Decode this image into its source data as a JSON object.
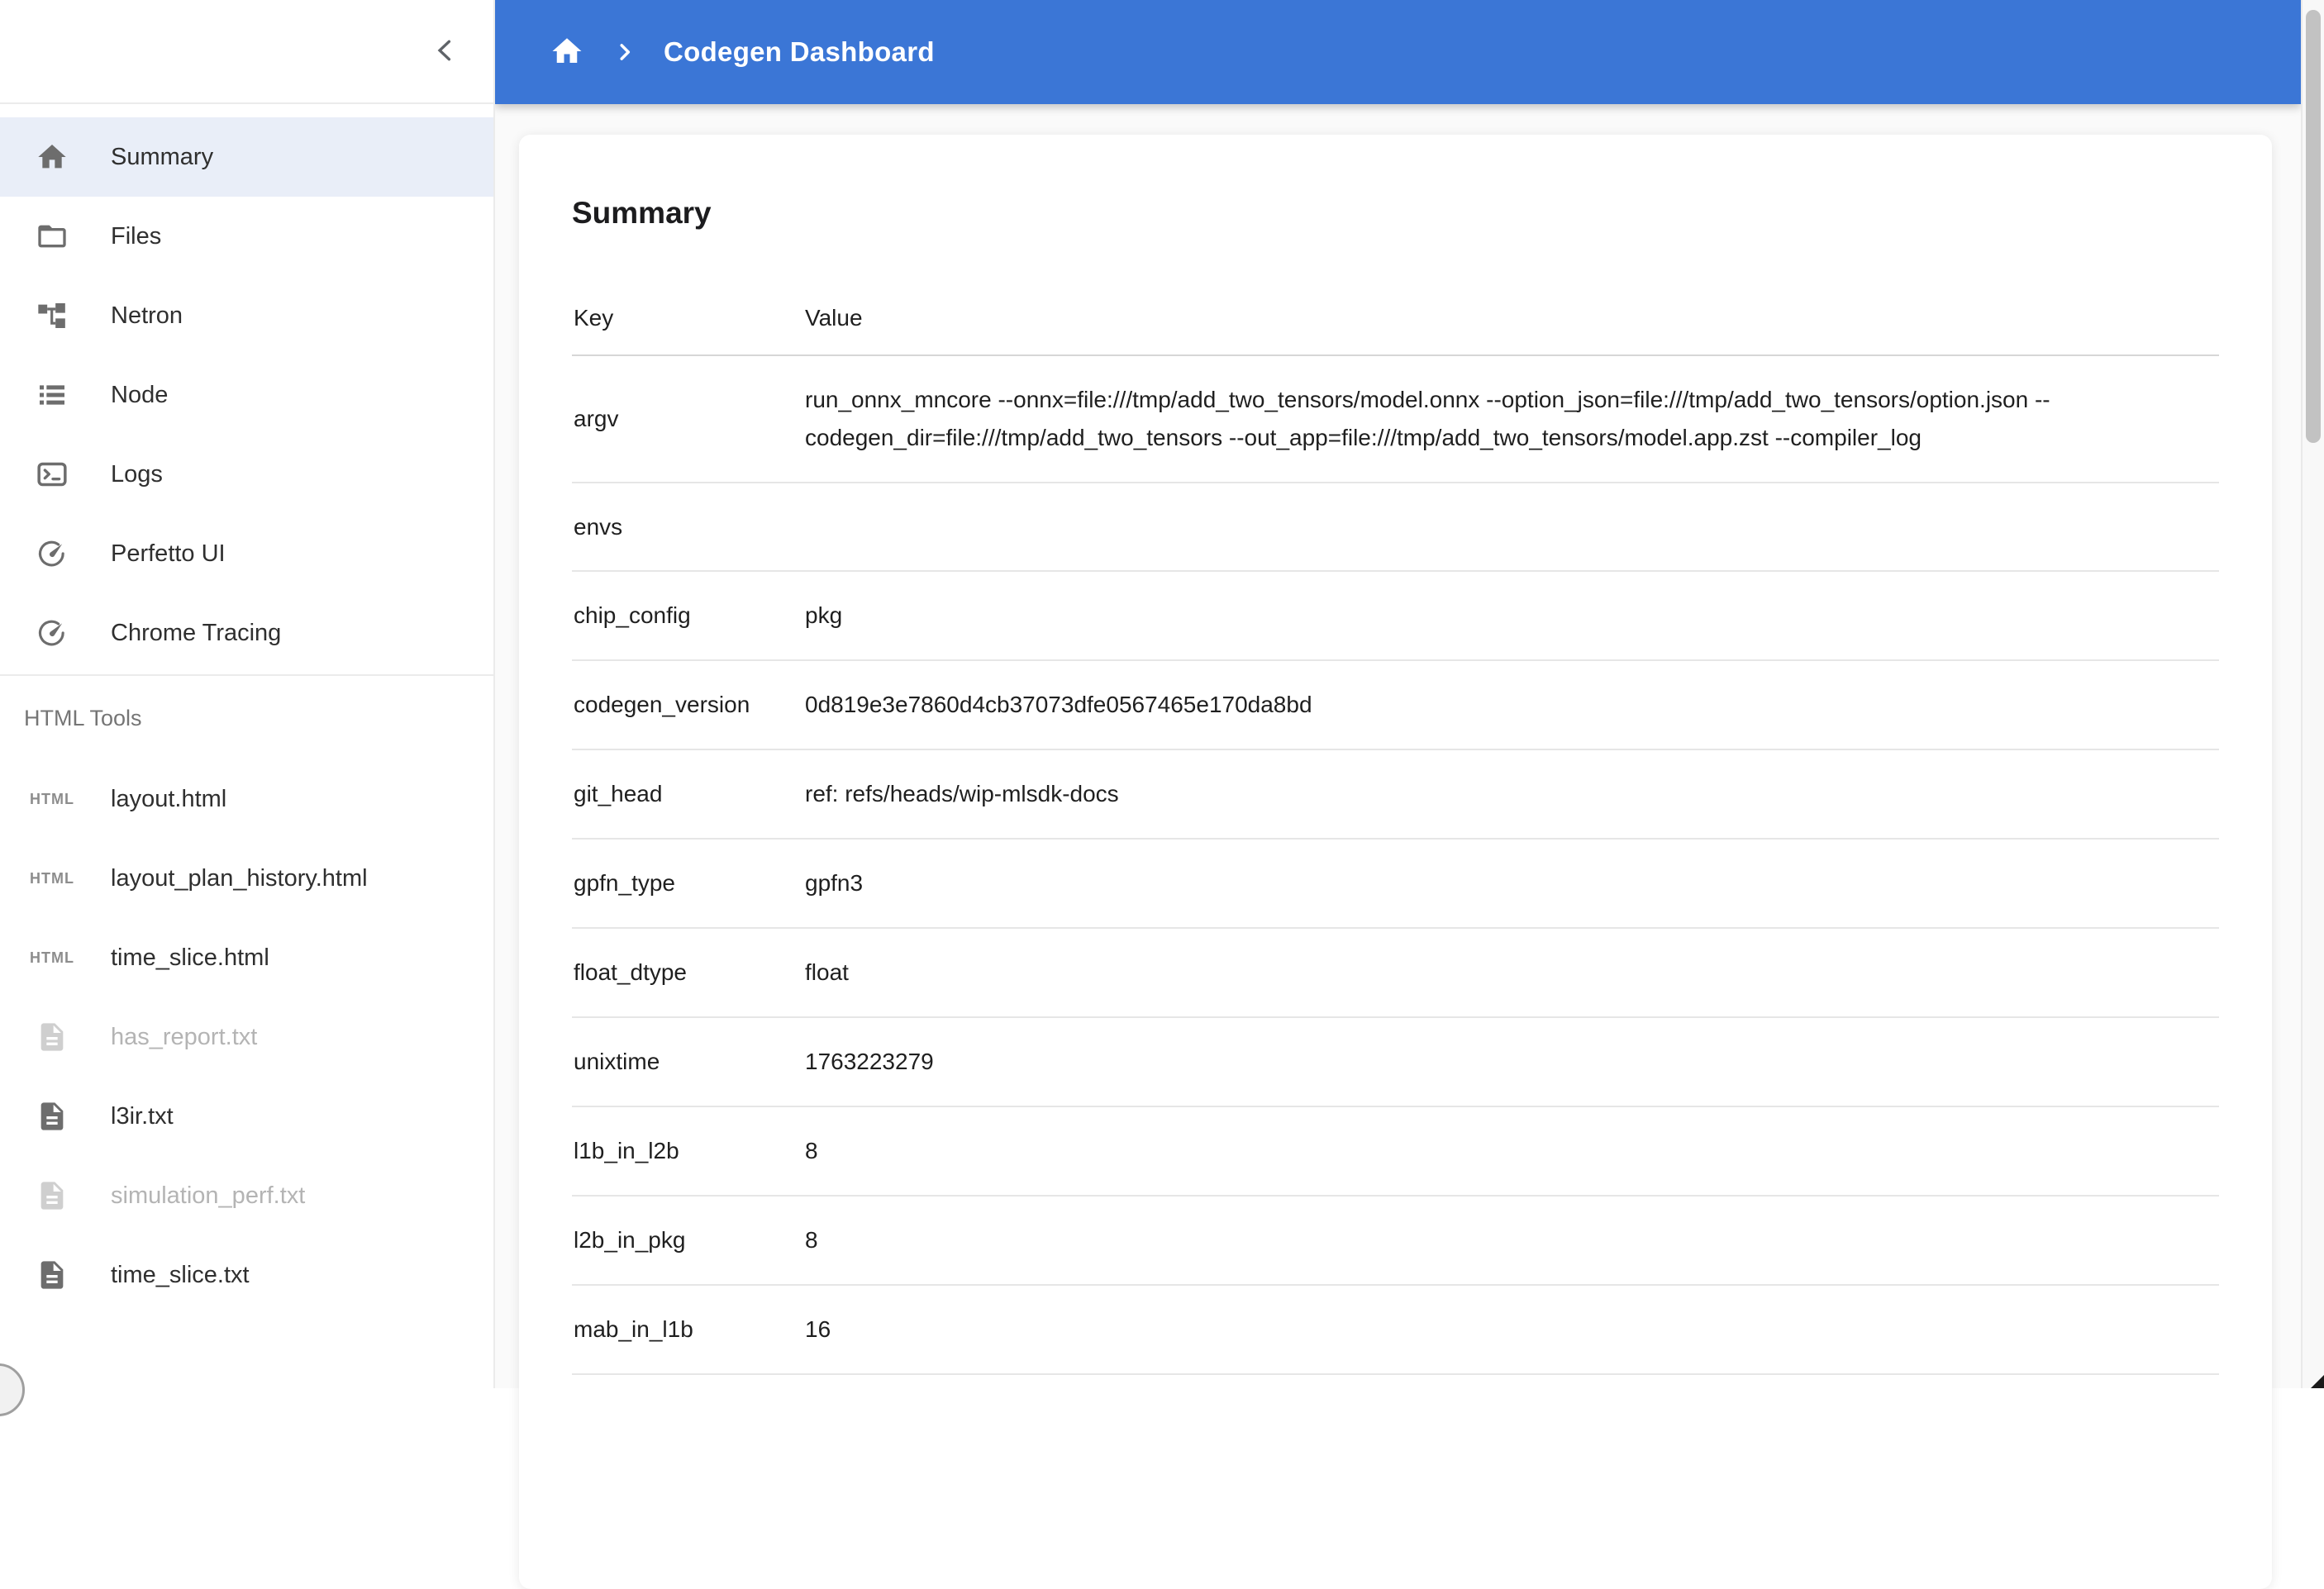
{
  "header": {
    "breadcrumb": {
      "title": "Codegen Dashboard"
    }
  },
  "sidebar": {
    "nav_items": [
      {
        "label": "Summary",
        "icon": "home-icon",
        "active": true
      },
      {
        "label": "Files",
        "icon": "folder-icon"
      },
      {
        "label": "Netron",
        "icon": "tree-icon"
      },
      {
        "label": "Node",
        "icon": "list-icon"
      },
      {
        "label": "Logs",
        "icon": "terminal-icon"
      },
      {
        "label": "Perfetto UI",
        "icon": "gauge-icon"
      },
      {
        "label": "Chrome Tracing",
        "icon": "gauge-icon"
      }
    ],
    "section_label": "HTML Tools",
    "tool_items": [
      {
        "label": "layout.html",
        "icon": "html-badge-icon"
      },
      {
        "label": "layout_plan_history.html",
        "icon": "html-badge-icon"
      },
      {
        "label": "time_slice.html",
        "icon": "html-badge-icon"
      },
      {
        "label": "has_report.txt",
        "icon": "file-text-icon",
        "disabled": true
      },
      {
        "label": "l3ir.txt",
        "icon": "file-text-icon"
      },
      {
        "label": "simulation_perf.txt",
        "icon": "file-text-icon",
        "disabled": true
      },
      {
        "label": "time_slice.txt",
        "icon": "file-text-icon"
      }
    ]
  },
  "main": {
    "title": "Summary",
    "table": {
      "columns": [
        "Key",
        "Value"
      ],
      "rows": [
        {
          "key": "argv",
          "value": "run_onnx_mncore --onnx=file:///tmp/add_two_tensors/model.onnx --option_json=file:///tmp/add_two_tensors/option.json --codegen_dir=file:///tmp/add_two_tensors --out_app=file:///tmp/add_two_tensors/model.app.zst --compiler_log"
        },
        {
          "key": "envs",
          "value": ""
        },
        {
          "key": "chip_config",
          "value": "pkg"
        },
        {
          "key": "codegen_version",
          "value": "0d819e3e7860d4cb37073dfe0567465e170da8bd"
        },
        {
          "key": "git_head",
          "value": "ref: refs/heads/wip-mlsdk-docs"
        },
        {
          "key": "gpfn_type",
          "value": "gpfn3"
        },
        {
          "key": "float_dtype",
          "value": "float"
        },
        {
          "key": "unixtime",
          "value": "1763223279"
        },
        {
          "key": "l1b_in_l2b",
          "value": "8"
        },
        {
          "key": "l2b_in_pkg",
          "value": "8"
        },
        {
          "key": "mab_in_l1b",
          "value": "16"
        }
      ]
    }
  },
  "colors": {
    "header_bg": "#3b76d6",
    "active_item_bg": "#e9eef8",
    "sidebar_icon": "#6d6d6d",
    "disabled_text": "#b4b4b4",
    "row_divider": "#e6e6e6",
    "scroll_thumb": "#c2c2c2"
  }
}
